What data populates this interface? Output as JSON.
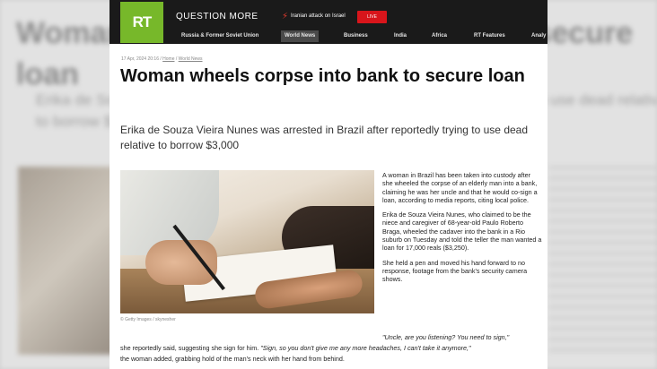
{
  "background": {
    "title": "Woman wheels corpse into bank to secure loan",
    "subtitle": "Erika de Souza Vieira Nunes was arrested in Brazil after reportedly trying to use dead relative to borrow $3,000"
  },
  "header": {
    "logo": "RT",
    "tagline": "QUESTION MORE",
    "breaking_text": "Iranian attack on Israel",
    "live_label": "LIVE",
    "nav": [
      "Russia & Former Soviet Union",
      "World News",
      "Business",
      "India",
      "Africa",
      "RT Features",
      "Analy"
    ],
    "active_nav": "World News"
  },
  "article": {
    "date": "17 Apr, 2024 20:16",
    "breadcrumb": [
      "Home",
      "World News"
    ],
    "headline": "Woman wheels corpse into bank to secure loan",
    "subtitle": "Erika de Souza Vieira Nunes was arrested in Brazil after reportedly trying to use dead relative to borrow $3,000",
    "photo_credit": "© Getty Images / skynesher",
    "paragraphs": [
      "A woman in Brazil has been taken into custody after she wheeled the corpse of an elderly man into a bank, claiming he was her uncle and that he would co-sign a loan, according to media reports, citing local police.",
      "Erika de Souza Vieira Nunes, who claimed to be the niece and caregiver of 68-year-old Paulo Roberto Braga, wheeled the cadaver into the bank in a Rio suburb on Tuesday and told the teller the man wanted a loan for 17,000 reals ($3,250).",
      "She held a pen and moved his hand forward to no response, footage from the bank's security camera shows."
    ],
    "quote1": "\"Uncle, are you listening? You need to sign,\"",
    "line2_a": "she reportedly said, suggesting she sign for him. ",
    "line2_quote": "\"Sign, so you don't give me any more headaches, I can't take it anymore,\"",
    "line3": "the woman added, grabbing hold of the man's neck with her hand from behind."
  },
  "colors": {
    "brand_green": "#77b82a",
    "live_red": "#d8151b",
    "topbar": "#1a1a1a"
  }
}
